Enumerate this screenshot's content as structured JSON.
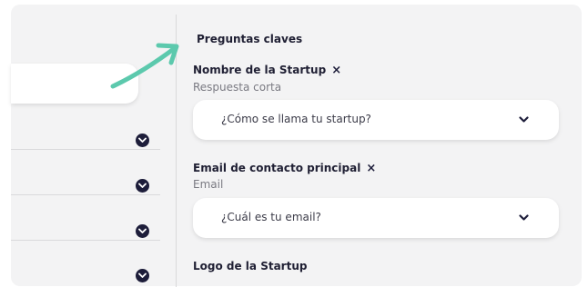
{
  "form": {
    "section_title": "Preguntas claves",
    "questions": [
      {
        "label": "Nombre de la Startup",
        "remove_icon": "×",
        "type": "Respuesta corta",
        "placeholder": "¿Cómo se llama tu startup?"
      },
      {
        "label": "Email de contacto principal",
        "remove_icon": "×",
        "type": "Email",
        "placeholder": "¿Cuál es tu email?"
      },
      {
        "label": "Logo de la Startup"
      }
    ]
  },
  "colors": {
    "accent_arrow": "#5cc9ad",
    "dark_icon": "#1d1d3a",
    "panel_bg": "#f3f3f4"
  },
  "icons": [
    "arrow-pointer-icon",
    "chevron-down-circle-icon",
    "chevron-down-icon",
    "close-icon"
  ]
}
